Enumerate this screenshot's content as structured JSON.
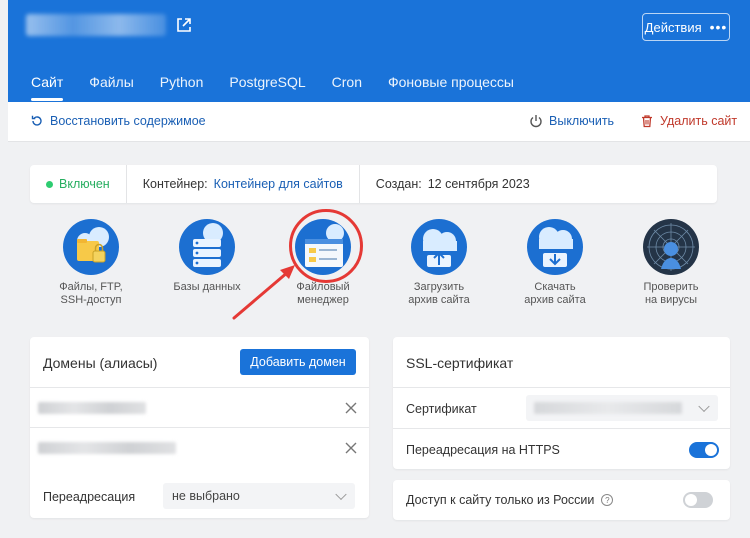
{
  "header": {
    "actions_label": "Действия",
    "actions_dots": "•••",
    "tabs": [
      {
        "label": "Сайт",
        "active": true
      },
      {
        "label": "Файлы"
      },
      {
        "label": "Python"
      },
      {
        "label": "PostgreSQL"
      },
      {
        "label": "Cron"
      },
      {
        "label": "Фоновые процессы"
      }
    ]
  },
  "toolbar": {
    "restore_label": "Восстановить содержимое",
    "disable_label": "Выключить",
    "delete_label": "Удалить сайт"
  },
  "status": {
    "state": "Включен",
    "container_label": "Контейнер:",
    "container_value": "Контейнер для сайтов",
    "created_label": "Создан:",
    "created_value": "12 сентября 2023"
  },
  "tiles": [
    {
      "line1": "Файлы, FTP,",
      "line2": "SSH-доступ"
    },
    {
      "line1": "Базы данных",
      "line2": ""
    },
    {
      "line1": "Файловый",
      "line2": "менеджер"
    },
    {
      "line1": "Загрузить",
      "line2": "архив сайта"
    },
    {
      "line1": "Скачать",
      "line2": "архив сайта"
    },
    {
      "line1": "Проверить",
      "line2": "на вирусы"
    }
  ],
  "domains": {
    "title": "Домены (алиасы)",
    "add_button": "Добавить домен",
    "redirect_label": "Переадресация",
    "redirect_value": "не выбрано"
  },
  "ssl": {
    "title": "SSL-сертификат",
    "cert_label": "Сертификат",
    "https_label": "Переадресация на HTTPS",
    "https_enabled": true
  },
  "russia_access": {
    "label": "Доступ к сайту только из России",
    "help": "?",
    "enabled": false
  },
  "colors": {
    "accent": "#1a73d9",
    "danger": "#c0392b",
    "success": "#2ecc71",
    "highlight": "#e53935"
  }
}
